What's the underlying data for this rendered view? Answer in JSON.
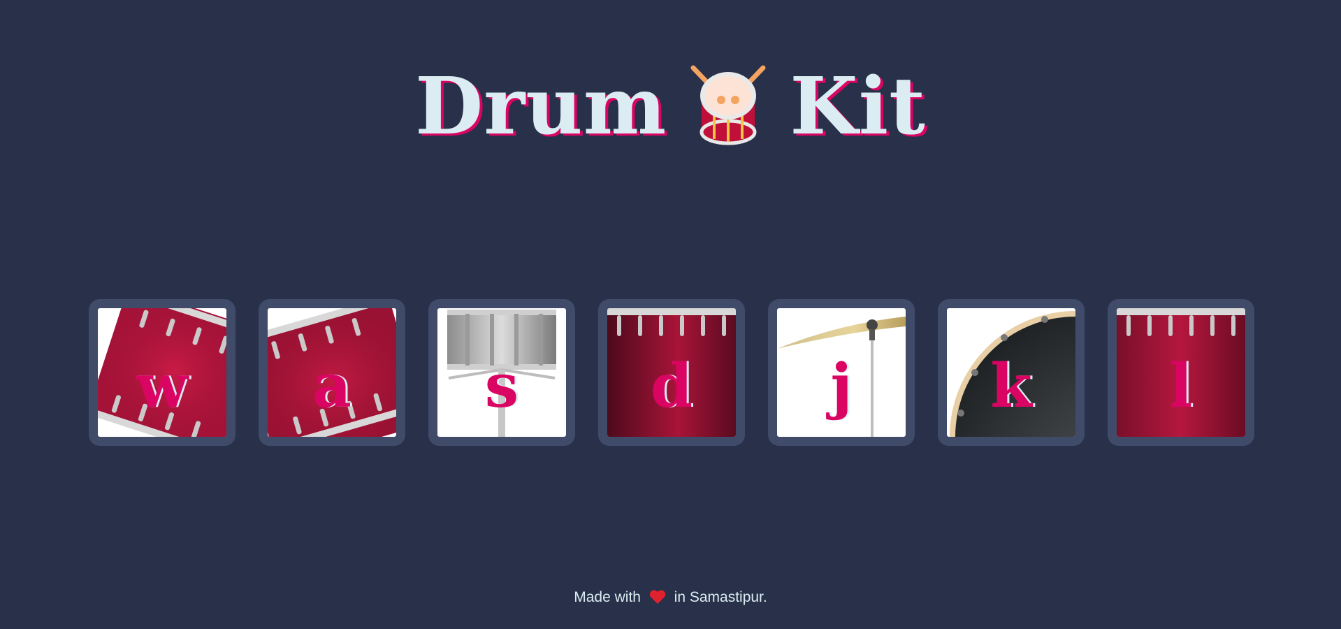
{
  "title": {
    "before": "Drum",
    "emoji_icon": "drum-emoji",
    "after": "Kit"
  },
  "drums": [
    {
      "key": "w",
      "image": "tom-drum-rotated",
      "accent": "#a01435"
    },
    {
      "key": "a",
      "image": "tom-drum-tilted",
      "accent": "#a01435"
    },
    {
      "key": "s",
      "image": "snare-drum",
      "accent": "#a9a9a9"
    },
    {
      "key": "d",
      "image": "floor-tom",
      "accent": "#7d0f2c"
    },
    {
      "key": "j",
      "image": "crash-cymbal",
      "accent": "#c8b37a"
    },
    {
      "key": "k",
      "image": "kick-drum",
      "accent": "#2e3133"
    },
    {
      "key": "l",
      "image": "bass-drum",
      "accent": "#8f1232"
    }
  ],
  "footer": {
    "before": "Made with",
    "icon": "heart-icon",
    "after": "in Samastipur."
  },
  "colors": {
    "background": "#283149",
    "tile_border": "#404b69",
    "title_text": "#dbedf3",
    "accent_pink": "#da0463"
  }
}
